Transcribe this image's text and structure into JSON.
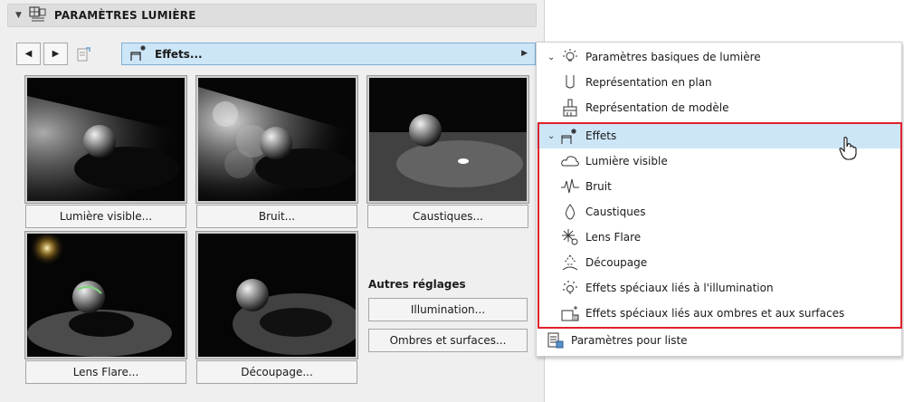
{
  "panel": {
    "title": "PARAMÈTRES LUMIÈRE",
    "effects_dropdown": "Effets..."
  },
  "thumbnails": [
    {
      "label": "Lumière visible..."
    },
    {
      "label": "Bruit..."
    },
    {
      "label": "Caustiques..."
    },
    {
      "label": "Lens Flare..."
    },
    {
      "label": "Découpage..."
    }
  ],
  "other_settings": {
    "heading": "Autres réglages",
    "illumination": "Illumination...",
    "shadows": "Ombres et surfaces..."
  },
  "tree": {
    "items": [
      {
        "label": "Paramètres basiques de lumière",
        "icon": "bulb-icon"
      },
      {
        "label": "Représentation en plan",
        "icon": "plan-icon"
      },
      {
        "label": "Représentation de modèle",
        "icon": "brush-icon"
      },
      {
        "label": "Effets",
        "icon": "effects-icon"
      },
      {
        "label": "Lumière visible",
        "icon": "cloud-icon"
      },
      {
        "label": "Bruit",
        "icon": "noise-icon"
      },
      {
        "label": "Caustiques",
        "icon": "drop-icon"
      },
      {
        "label": "Lens Flare",
        "icon": "flare-icon"
      },
      {
        "label": "Découpage",
        "icon": "cutoff-icon"
      },
      {
        "label": "Effets spéciaux liés à l'illumination",
        "icon": "illumination-effects-icon"
      },
      {
        "label": "Effets spéciaux liés aux ombres et aux surfaces",
        "icon": "shadow-effects-icon"
      },
      {
        "label": "Paramètres pour liste",
        "icon": "list-icon"
      }
    ]
  },
  "colors": {
    "selection": "#cde6f7",
    "highlight_border": "#e0202a"
  }
}
